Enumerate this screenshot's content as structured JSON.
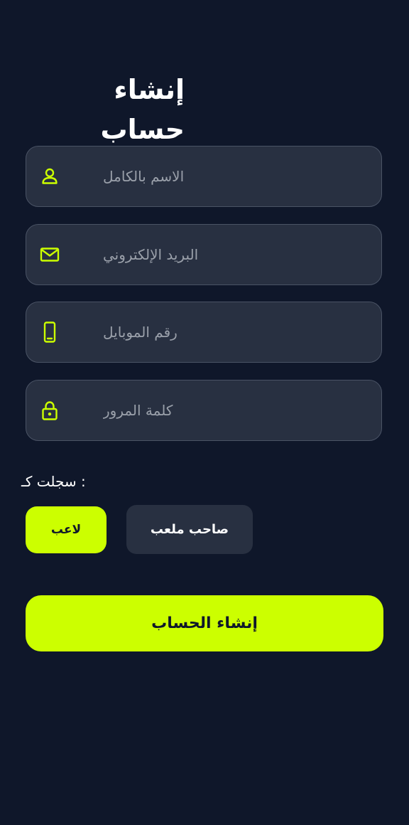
{
  "title": "إنشاء حساب",
  "fields": [
    {
      "placeholder": "الاسم بالكامل",
      "icon": "user-icon",
      "type": "text"
    },
    {
      "placeholder": "البريد الإلكتروني",
      "icon": "mail-icon",
      "type": "email"
    },
    {
      "placeholder": "رقم الموبايل",
      "icon": "phone-icon",
      "type": "tel"
    },
    {
      "placeholder": "كلمة المرور",
      "icon": "lock-icon",
      "type": "password"
    }
  ],
  "register_as": {
    "label": ": سجلت كـ",
    "options": [
      {
        "label": "لاعب",
        "selected": true
      },
      {
        "label": "صاحب ملعب",
        "selected": false
      }
    ]
  },
  "submit_label": "إنشاء الحساب",
  "colors": {
    "background": "#0f172a",
    "field_background": "#283041",
    "field_border": "#4a5365",
    "accent": "#ccff00",
    "placeholder": "#9aa0aa",
    "text": "#ffffff"
  }
}
